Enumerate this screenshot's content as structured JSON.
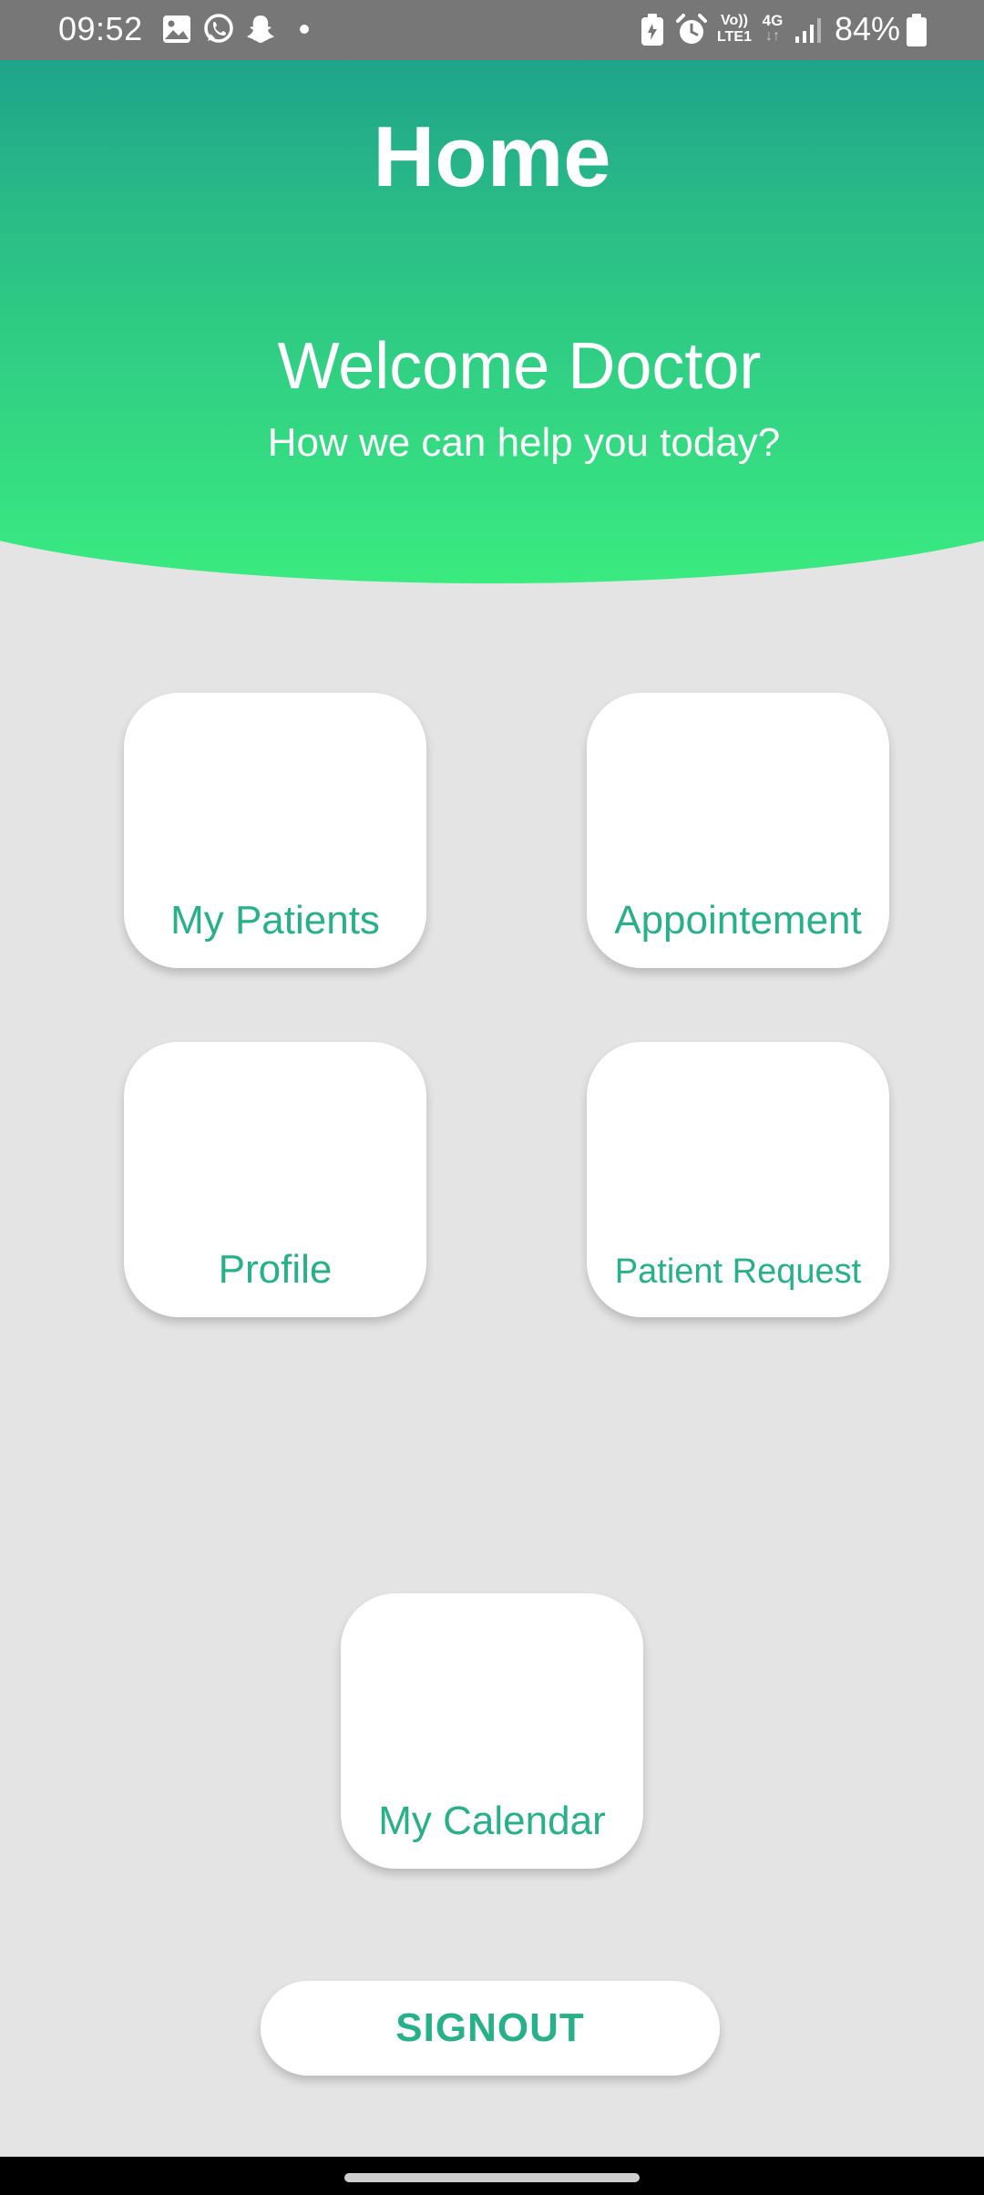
{
  "status_bar": {
    "time": "09:52",
    "battery_percent": "84%",
    "network_type": "4G",
    "volte_label_top": "Vo))",
    "volte_label_bottom": "LTE1",
    "signal_bars_filled": 3,
    "signal_bars_total": 4,
    "left_icons": [
      "gallery-icon",
      "whatsapp-icon",
      "snapchat-icon",
      "dot-icon"
    ],
    "right_icons": [
      "battery-saver-icon",
      "alarm-icon",
      "volte-icon",
      "network-4g-icon",
      "signal-icon",
      "battery-icon"
    ]
  },
  "header": {
    "title": "Home",
    "welcome": "Welcome Doctor",
    "subtitle": "How we can help you today?",
    "gradient_top": "#1a9b8c",
    "gradient_bottom": "#3aeb80"
  },
  "menu": {
    "my_patients": "My Patients",
    "appointment": "Appointement",
    "profile": "Profile",
    "patient_request": "Patient Request",
    "my_calendar": "My Calendar"
  },
  "actions": {
    "signout": "SIGNOUT"
  },
  "colors": {
    "accent": "#27b08a",
    "background": "#e4e4e4",
    "card": "#ffffff",
    "status_bar": "#777777"
  }
}
